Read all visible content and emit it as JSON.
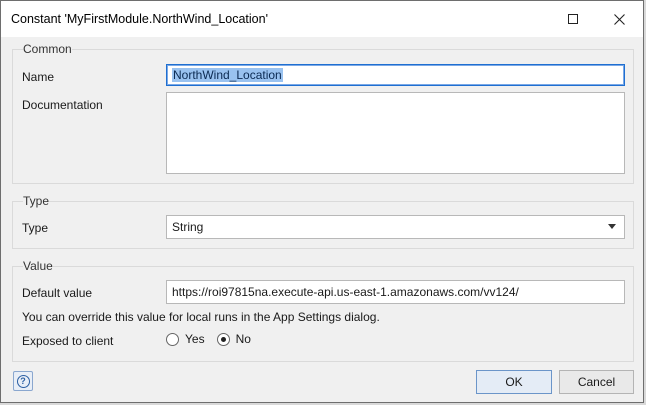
{
  "window": {
    "title": "Constant 'MyFirstModule.NorthWind_Location'",
    "maximize_icon": "maximize-icon",
    "close_icon": "close-icon"
  },
  "common": {
    "group_label": "Common",
    "name_label": "Name",
    "name_value": "NorthWind_Location",
    "documentation_label": "Documentation",
    "documentation_value": ""
  },
  "type": {
    "group_label": "Type",
    "type_label": "Type",
    "type_value": "String"
  },
  "value": {
    "group_label": "Value",
    "default_value_label": "Default value",
    "default_value": "https://roi97815na.execute-api.us-east-1.amazonaws.com/vv124/",
    "hint": "You can override this value for local runs in the App Settings dialog.",
    "exposed_label": "Exposed to client",
    "yes_label": "Yes",
    "no_label": "No",
    "exposed_selected": "No"
  },
  "footer": {
    "help_icon": "help-icon",
    "ok_label": "OK",
    "cancel_label": "Cancel"
  },
  "colors": {
    "accent": "#1f6fd1",
    "selection": "#99c2f0"
  }
}
